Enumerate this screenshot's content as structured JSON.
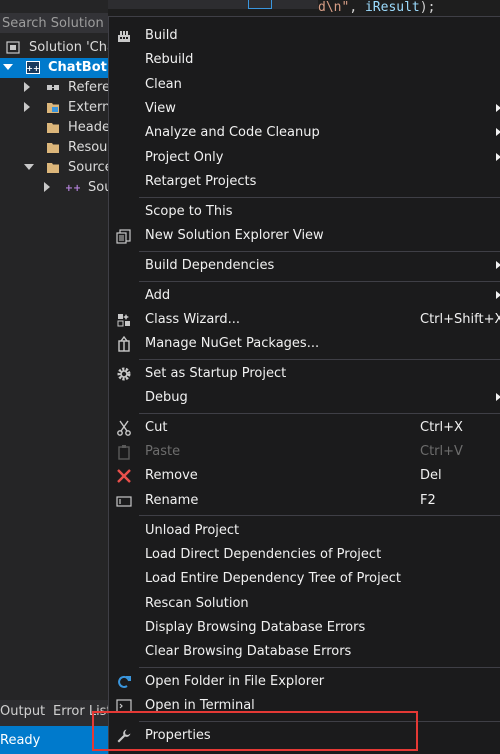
{
  "solution_explorer": {
    "search_placeholder": "Search Solution Ex",
    "solution_label": "Solution 'Cha",
    "project_label": "ChatBot",
    "items": [
      {
        "label": "Refere"
      },
      {
        "label": "Extern"
      },
      {
        "label": "Heade"
      },
      {
        "label": "Resour"
      },
      {
        "label": "Source"
      },
      {
        "label": "Sou"
      }
    ]
  },
  "editor": {
    "snippet_string": "d\\n\"",
    "snippet_rest": ", ",
    "snippet_var": "iResult",
    "snippet_end": ");"
  },
  "bottom_tabs": {
    "output": "Output",
    "error_list": "Error List"
  },
  "status_bar": {
    "text": "Ready"
  },
  "context_menu": {
    "build": "Build",
    "rebuild": "Rebuild",
    "clean": "Clean",
    "view": "View",
    "analyze": "Analyze and Code Cleanup",
    "project_only": "Project Only",
    "retarget": "Retarget Projects",
    "scope": "Scope to This",
    "new_view": "New Solution Explorer View",
    "build_deps": "Build Dependencies",
    "add": "Add",
    "class_wizard": "Class Wizard...",
    "class_wizard_sc": "Ctrl+Shift+X",
    "nuget": "Manage NuGet Packages...",
    "startup": "Set as Startup Project",
    "debug": "Debug",
    "cut": "Cut",
    "cut_sc": "Ctrl+X",
    "paste": "Paste",
    "paste_sc": "Ctrl+V",
    "remove": "Remove",
    "remove_sc": "Del",
    "rename": "Rename",
    "rename_sc": "F2",
    "unload": "Unload Project",
    "load_direct": "Load Direct Dependencies of Project",
    "load_tree": "Load Entire Dependency Tree of Project",
    "rescan": "Rescan Solution",
    "display_errors": "Display Browsing Database Errors",
    "clear_errors": "Clear Browsing Database Errors",
    "open_folder": "Open Folder in File Explorer",
    "open_terminal": "Open in Terminal",
    "properties": "Properties"
  },
  "colors": {
    "accent": "#007acc",
    "highlight": "#e53935",
    "menu_bg": "#1b1b1c"
  }
}
